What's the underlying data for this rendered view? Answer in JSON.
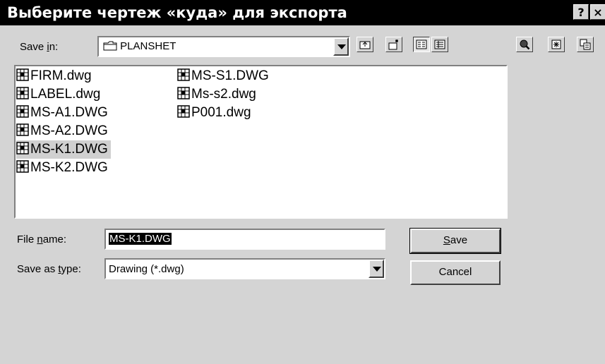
{
  "dialog": {
    "title": "Выберите чертеж «куда» для экспорта",
    "help_button": "?",
    "close_button": "×"
  },
  "save_in": {
    "label_pre": "Save ",
    "label_accel": "i",
    "label_post": "n:",
    "value": "PLANSHET"
  },
  "toolbar": {
    "icons": [
      "up-folder-icon",
      "new-folder-icon",
      "list-view-icon",
      "details-view-icon"
    ],
    "extra_icons": [
      "find-file-icon",
      "locate-icon",
      "partial-open-icon"
    ]
  },
  "files": {
    "column1": [
      "FIRM.dwg",
      "LABEL.dwg",
      "MS-A1.DWG",
      "MS-A2.DWG",
      "MS-K1.DWG",
      "MS-K2.DWG"
    ],
    "column2": [
      "MS-S1.DWG",
      "Ms-s2.dwg",
      "P001.dwg"
    ],
    "selected": "MS-K1.DWG"
  },
  "file_name": {
    "label_pre": "File ",
    "label_accel": "n",
    "label_post": "ame:",
    "value": "MS-K1.DWG"
  },
  "save_as_type": {
    "label_pre": "Save as ",
    "label_accel": "t",
    "label_post": "ype:",
    "value": "Drawing (*.dwg)"
  },
  "buttons": {
    "save_accel": "S",
    "save_rest": "ave",
    "cancel": "Cancel"
  }
}
